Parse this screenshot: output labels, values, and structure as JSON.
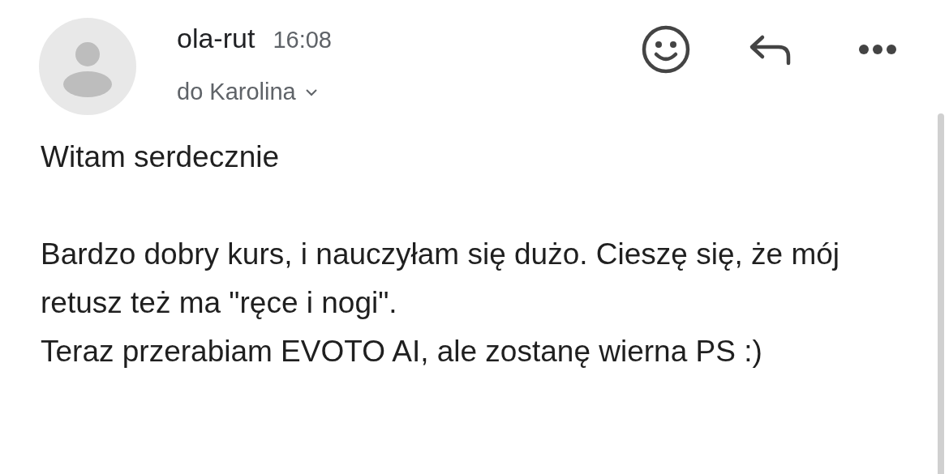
{
  "sender": {
    "name": "ola-rut",
    "time": "16:08",
    "recipient": "do Karolina"
  },
  "body": {
    "greeting": "Witam serdecznie",
    "paragraphs": [
      "Bardzo dobry kurs, i nauczyłam się dużo. Cieszę się, że mój retusz też ma \"ręce i nogi\".",
      "Teraz przerabiam EVOTO AI, ale zostanę wierna PS :)"
    ]
  }
}
